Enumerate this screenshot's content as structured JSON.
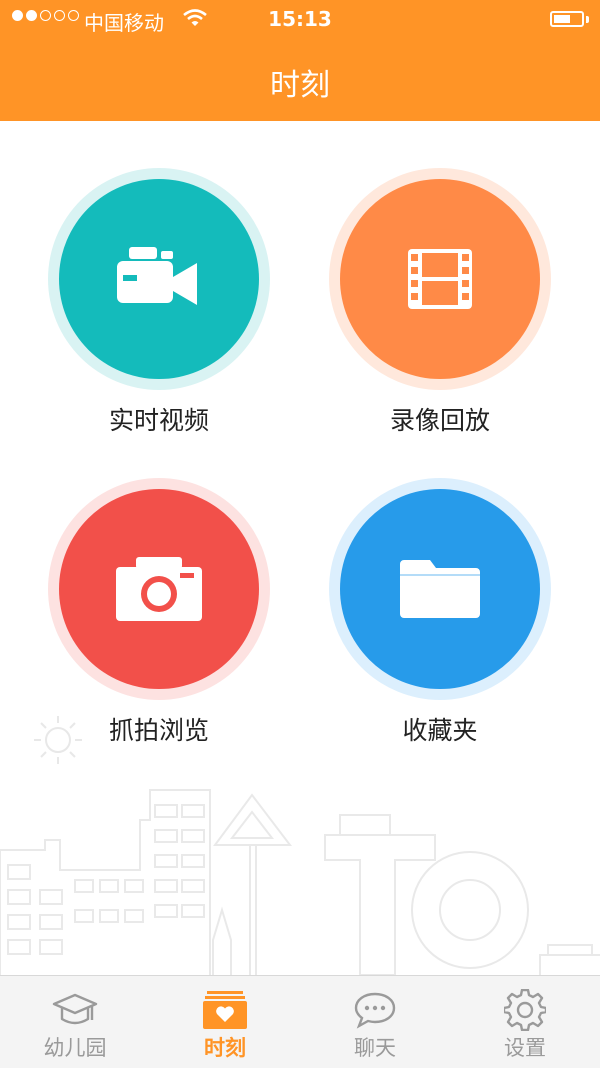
{
  "status_bar": {
    "carrier": "中国移动",
    "time": "15:13"
  },
  "header": {
    "title": "时刻"
  },
  "tiles": [
    {
      "label": "实时视频",
      "icon": "video-camera-icon",
      "color": "#14BBBB"
    },
    {
      "label": "录像回放",
      "icon": "film-icon",
      "color": "#FF8A47"
    },
    {
      "label": "抓拍浏览",
      "icon": "camera-icon",
      "color": "#F2504A"
    },
    {
      "label": "收藏夹",
      "icon": "folder-icon",
      "color": "#279BEA"
    }
  ],
  "tabbar": {
    "items": [
      {
        "label": "幼儿园",
        "icon": "graduation-cap-icon"
      },
      {
        "label": "时刻",
        "icon": "heart-box-icon",
        "active": true
      },
      {
        "label": "聊天",
        "icon": "chat-bubble-icon"
      },
      {
        "label": "设置",
        "icon": "gear-icon"
      }
    ]
  },
  "colors": {
    "brand": "#FF9426",
    "inactive_tab": "#9a9a9a"
  }
}
